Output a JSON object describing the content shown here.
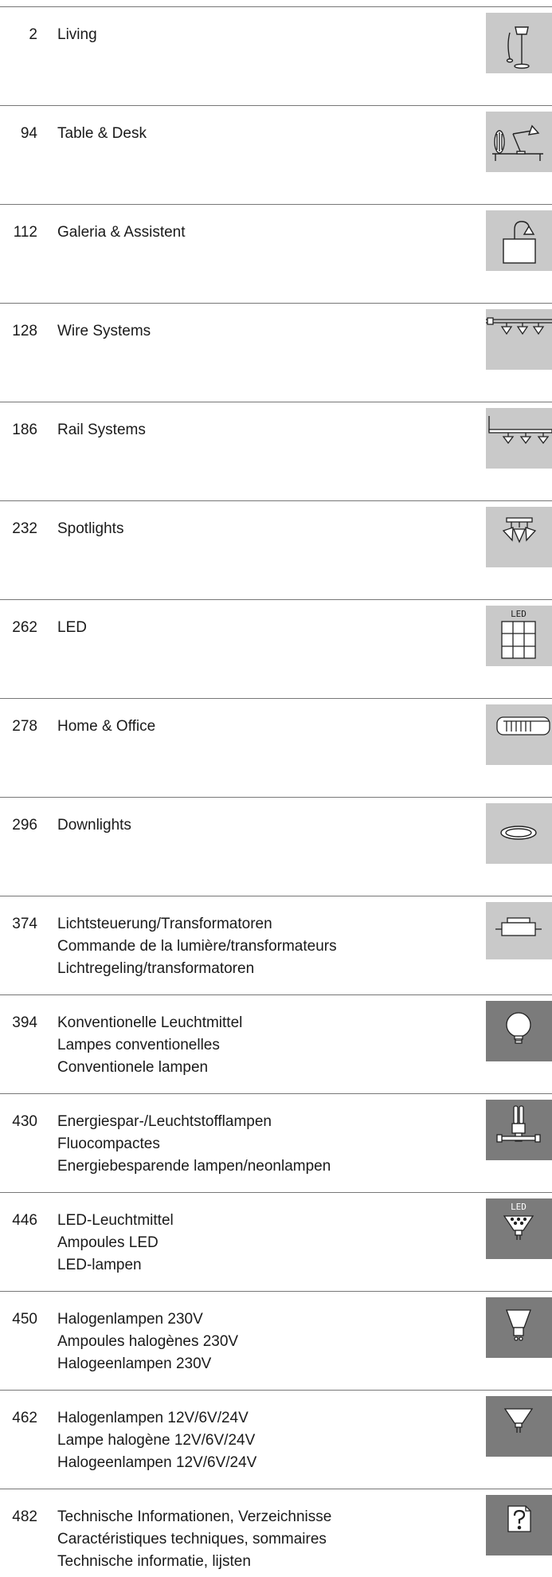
{
  "entries": [
    {
      "page": "2",
      "lines": [
        "Living"
      ],
      "icon": "floor-lamp-icon",
      "tone": "light"
    },
    {
      "page": "94",
      "lines": [
        "Table & Desk"
      ],
      "icon": "desk-lamp-icon",
      "tone": "light"
    },
    {
      "page": "112",
      "lines": [
        "Galeria & Assistent"
      ],
      "icon": "wall-lamp-icon",
      "tone": "light"
    },
    {
      "page": "128",
      "lines": [
        "Wire Systems"
      ],
      "icon": "wire-system-icon",
      "tone": "light"
    },
    {
      "page": "186",
      "lines": [
        "Rail Systems"
      ],
      "icon": "rail-system-icon",
      "tone": "light"
    },
    {
      "page": "232",
      "lines": [
        "Spotlights"
      ],
      "icon": "spotlights-icon",
      "tone": "light"
    },
    {
      "page": "262",
      "lines": [
        "LED"
      ],
      "icon": "led-panel-icon",
      "tone": "light"
    },
    {
      "page": "278",
      "lines": [
        "Home & Office"
      ],
      "icon": "office-luminaire-icon",
      "tone": "light"
    },
    {
      "page": "296",
      "lines": [
        "Downlights"
      ],
      "icon": "downlight-icon",
      "tone": "light"
    },
    {
      "page": "374",
      "lines": [
        "Lichtsteuerung/Transformatoren",
        "Commande de la lumière/transformateurs",
        "Lichtregeling/transformatoren"
      ],
      "icon": "transformer-icon",
      "tone": "light"
    },
    {
      "page": "394",
      "lines": [
        "Konventionelle Leuchtmittel",
        "Lampes conventionelles",
        "Conventionele lampen"
      ],
      "icon": "bulb-icon",
      "tone": "dark"
    },
    {
      "page": "430",
      "lines": [
        "Energiespar-/Leuchtstofflampen",
        "Fluocompactes",
        "Energiebesparende lampen/neonlampen"
      ],
      "icon": "energy-saving-lamp-icon",
      "tone": "dark"
    },
    {
      "page": "446",
      "lines": [
        "LED-Leuchtmittel",
        "Ampoules LED",
        "LED-lampen"
      ],
      "icon": "led-bulb-icon",
      "tone": "dark"
    },
    {
      "page": "450",
      "lines": [
        "Halogenlampen 230V",
        "Ampoules halogènes 230V",
        "Halogeenlampen 230V"
      ],
      "icon": "halogen-230v-icon",
      "tone": "dark"
    },
    {
      "page": "462",
      "lines": [
        "Halogenlampen 12V/6V/24V",
        "Lampe halogène 12V/6V/24V",
        "Halogeenlampen 12V/6V/24V"
      ],
      "icon": "halogen-12v-icon",
      "tone": "dark"
    },
    {
      "page": "482",
      "lines": [
        "Technische Informationen, Verzeichnisse",
        "Caractéristiques techniques, sommaires",
        "Technische informatie, lijsten"
      ],
      "icon": "document-question-icon",
      "tone": "dark"
    }
  ],
  "icon_labels": {
    "led_panel": "LED",
    "led_bulb": "LED"
  }
}
